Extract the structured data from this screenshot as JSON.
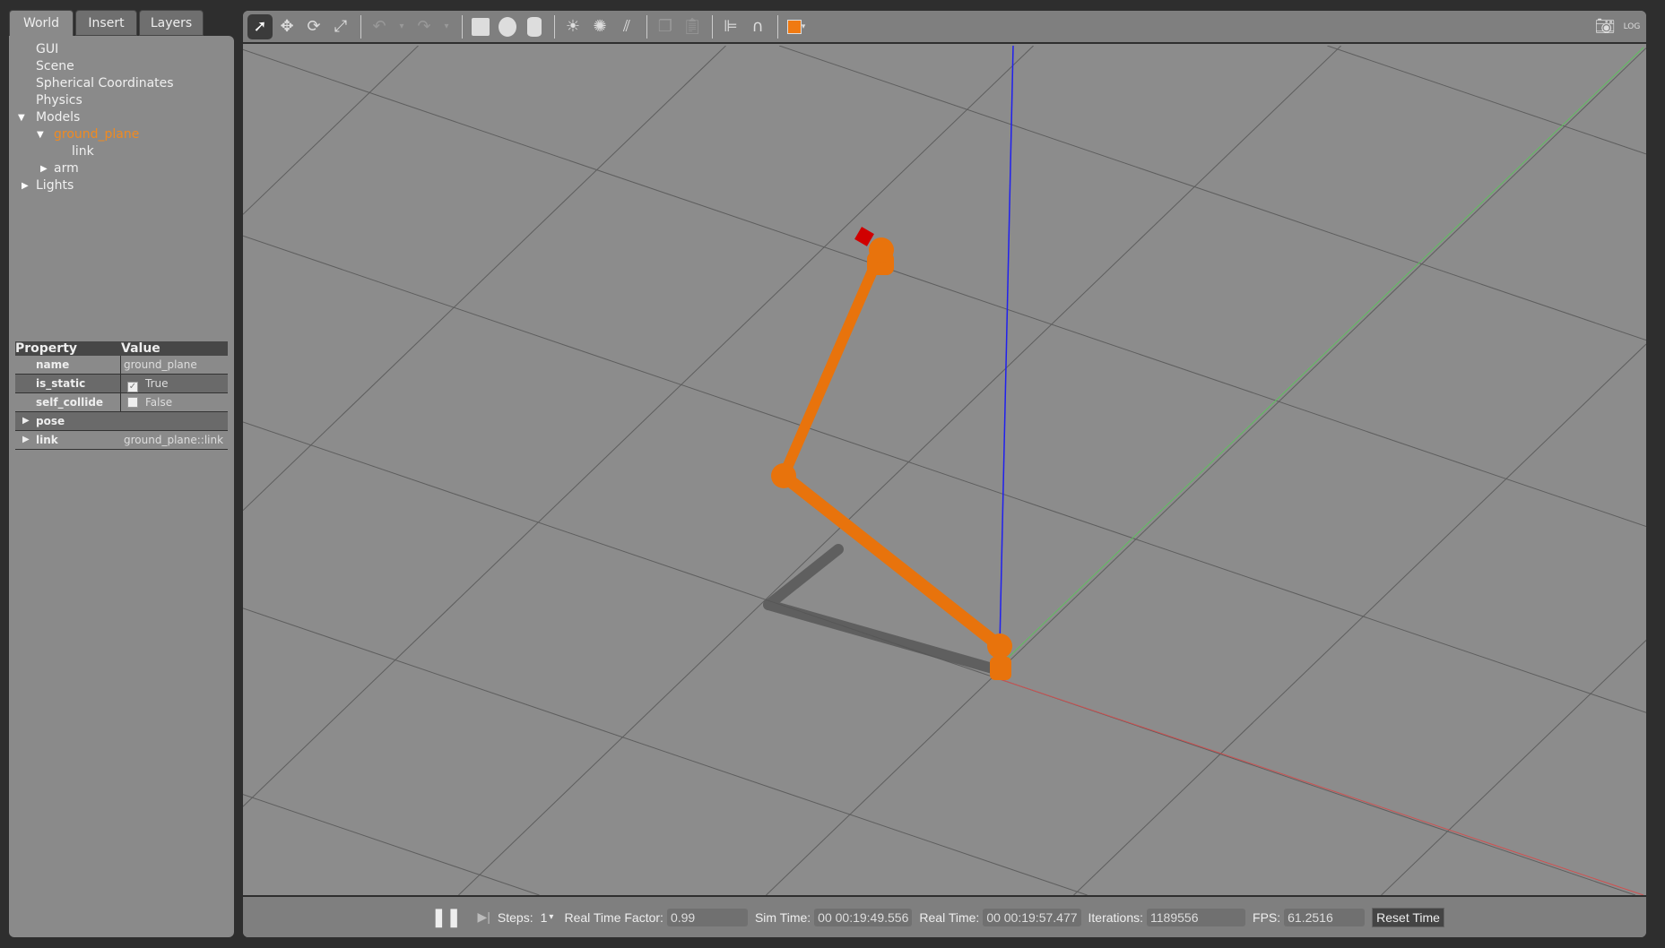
{
  "tabs": [
    {
      "label": "World"
    },
    {
      "label": "Insert"
    },
    {
      "label": "Layers"
    }
  ],
  "tree": {
    "gui": "GUI",
    "scene": "Scene",
    "spherical": "Spherical Coordinates",
    "physics": "Physics",
    "models": "Models",
    "ground_plane": "ground_plane",
    "link": "link",
    "arm": "arm",
    "lights": "Lights"
  },
  "props": {
    "h_property": "Property",
    "h_value": "Value",
    "rows": [
      {
        "k": "name",
        "v": "ground_plane"
      },
      {
        "k": "is_static",
        "v": "True",
        "checked": true
      },
      {
        "k": "self_collide",
        "v": "False",
        "checked": false
      },
      {
        "k": "pose",
        "v": ""
      },
      {
        "k": "link",
        "v": "ground_plane::link"
      }
    ]
  },
  "toolbar": {
    "tools": [
      "select-arrow",
      "translate",
      "rotate",
      "scale",
      "undo",
      "redo",
      "box",
      "sphere",
      "cylinder",
      "point-light",
      "spot-light",
      "directional-light",
      "copy",
      "paste",
      "align",
      "snap",
      "view-angle"
    ]
  },
  "bottom": {
    "steps_label": "Steps:",
    "steps_value": "1",
    "rtf_label": "Real Time Factor:",
    "rtf": "0.99",
    "sim_label": "Sim Time:",
    "sim": "00 00:19:49.556",
    "real_label": "Real Time:",
    "real": "00 00:19:57.477",
    "iter_label": "Iterations:",
    "iter": "1189556",
    "fps_label": "FPS:",
    "fps": "61.2516",
    "reset": "Reset Time"
  },
  "colors": {
    "accent": "#f07a12",
    "arm": "#e8730c",
    "selected_text": "#f08a20"
  }
}
